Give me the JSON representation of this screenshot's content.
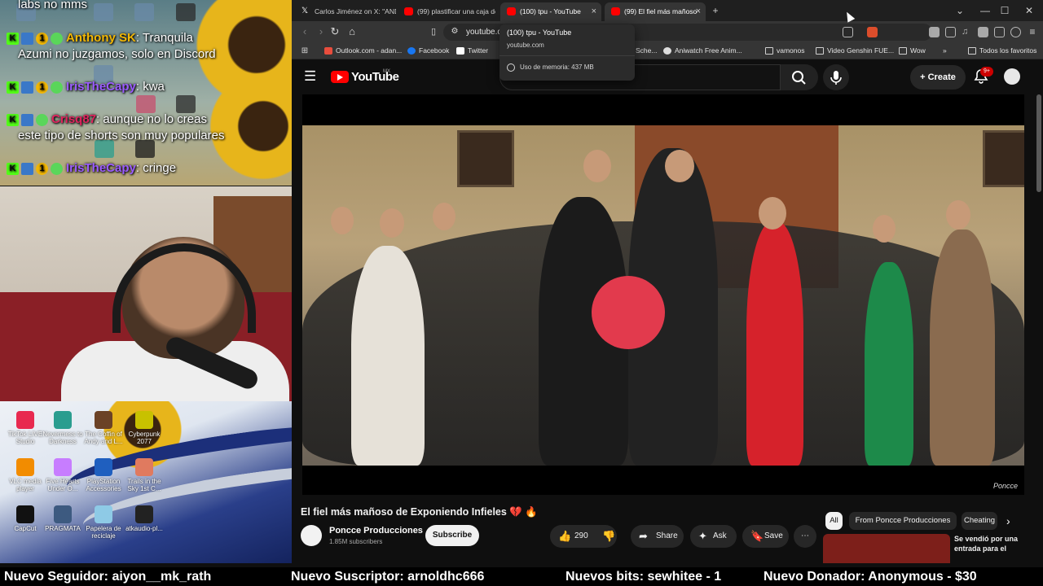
{
  "stream": {
    "chat": [
      {
        "user": "",
        "message": "labs no mms"
      },
      {
        "user": "Anthony SK",
        "message": ": Tranquila"
      },
      {
        "user": "",
        "message": "Azumi no juzgamos, solo en Discord"
      },
      {
        "user": "IrisTheCapy",
        "message": ": kwa"
      },
      {
        "user": "Crisq87",
        "message": ": aunque no lo creas"
      },
      {
        "user": "",
        "message": "este tipo de shorts son muy populares"
      },
      {
        "user": "IrisTheCapy",
        "message": ": cringe"
      }
    ],
    "badges": {
      "k": "K",
      "one": "1"
    },
    "user_color": "#9b5cff",
    "desktop_icons": [
      {
        "label": "TikTok LIVE Studio",
        "color": "#e8294f"
      },
      {
        "label": "Nevermess to Darkness",
        "color": "#2a9d8f"
      },
      {
        "label": "The Coffin of Andy and L...",
        "color": "#6b4226"
      },
      {
        "label": "Cyberpunk 2077",
        "color": "#c8c100"
      },
      {
        "label": "VLC media player",
        "color": "#f28c00"
      },
      {
        "label": "Five Hearts Under O...",
        "color": "#c77dff"
      },
      {
        "label": "PlayStation Accessories",
        "color": "#1f5fbf"
      },
      {
        "label": "Trails in the Sky 1st C...",
        "color": "#e07a5f"
      },
      {
        "label": "CapCut",
        "color": "#111111"
      },
      {
        "label": "PRAGMATA",
        "color": "#3d5a80"
      },
      {
        "label": "Papelera de reciclaje",
        "color": "#8ecae6"
      },
      {
        "label": "atkaudio-pl...",
        "color": "#222222"
      }
    ]
  },
  "browser": {
    "tabs": [
      {
        "title": "Carlos Jiménez on X: \"AND",
        "icon": "x-icon",
        "active": false
      },
      {
        "title": "(99) plastificar una caja de",
        "icon": "youtube-icon",
        "active": false
      },
      {
        "title": "(100) tpu - YouTube",
        "icon": "youtube-icon",
        "active": true
      },
      {
        "title": "(99) El fiel más mañoso",
        "icon": "youtube-icon",
        "active": true
      }
    ],
    "new_tab": "+",
    "window_controls": {
      "list": "⌄",
      "min": "—",
      "max": "☐",
      "close": "✕"
    },
    "url": "youtube.co",
    "bookmarks": [
      {
        "label": "Outlook.com - adan...",
        "color": "#e84d3d"
      },
      {
        "label": "Facebook",
        "color": "#1877f2"
      },
      {
        "label": "Twitter",
        "color": "#ffffff"
      },
      {
        "label": "Sche...",
        "color": "#888888"
      },
      {
        "label": "Aniwatch Free Anim...",
        "color": "#dddddd"
      },
      {
        "label": "vamonos",
        "color": "folder"
      },
      {
        "label": "Video Genshin FUE...",
        "color": "folder"
      },
      {
        "label": "Wow",
        "color": "folder"
      },
      {
        "label": "»",
        "color": ""
      },
      {
        "label": "Todos los favoritos",
        "color": "folder"
      }
    ],
    "tooltip": {
      "title": "(100) tpu - YouTube",
      "domain": "youtube.com",
      "memory": "Uso de memoria: 437 MB"
    }
  },
  "youtube": {
    "wordmark": "YouTube",
    "region": "MX",
    "create_label": "Create",
    "notifications": "9+",
    "video": {
      "title": "El fiel más mañoso de Exponiendo Infieles 💔 🔥",
      "channel": "Poncce Producciones",
      "subscribers": "1.85M subscribers",
      "subscribe_label": "Subscribe",
      "likes": "290",
      "share_label": "Share",
      "ask_label": "Ask",
      "save_label": "Save",
      "watermark": "Poncce"
    },
    "chips": [
      "All",
      "From Poncce Producciones",
      "Cheating"
    ],
    "recommended": {
      "title": "Se vendió por una entrada para el"
    }
  },
  "ticker": [
    "Nuevo Seguidor: aiyon__mk_rath",
    "Nuevo Suscriptor: arnoldhc666",
    "Nuevos bits: sewhitee - 1",
    "Nuevo Donador: Anonymous - $30"
  ]
}
